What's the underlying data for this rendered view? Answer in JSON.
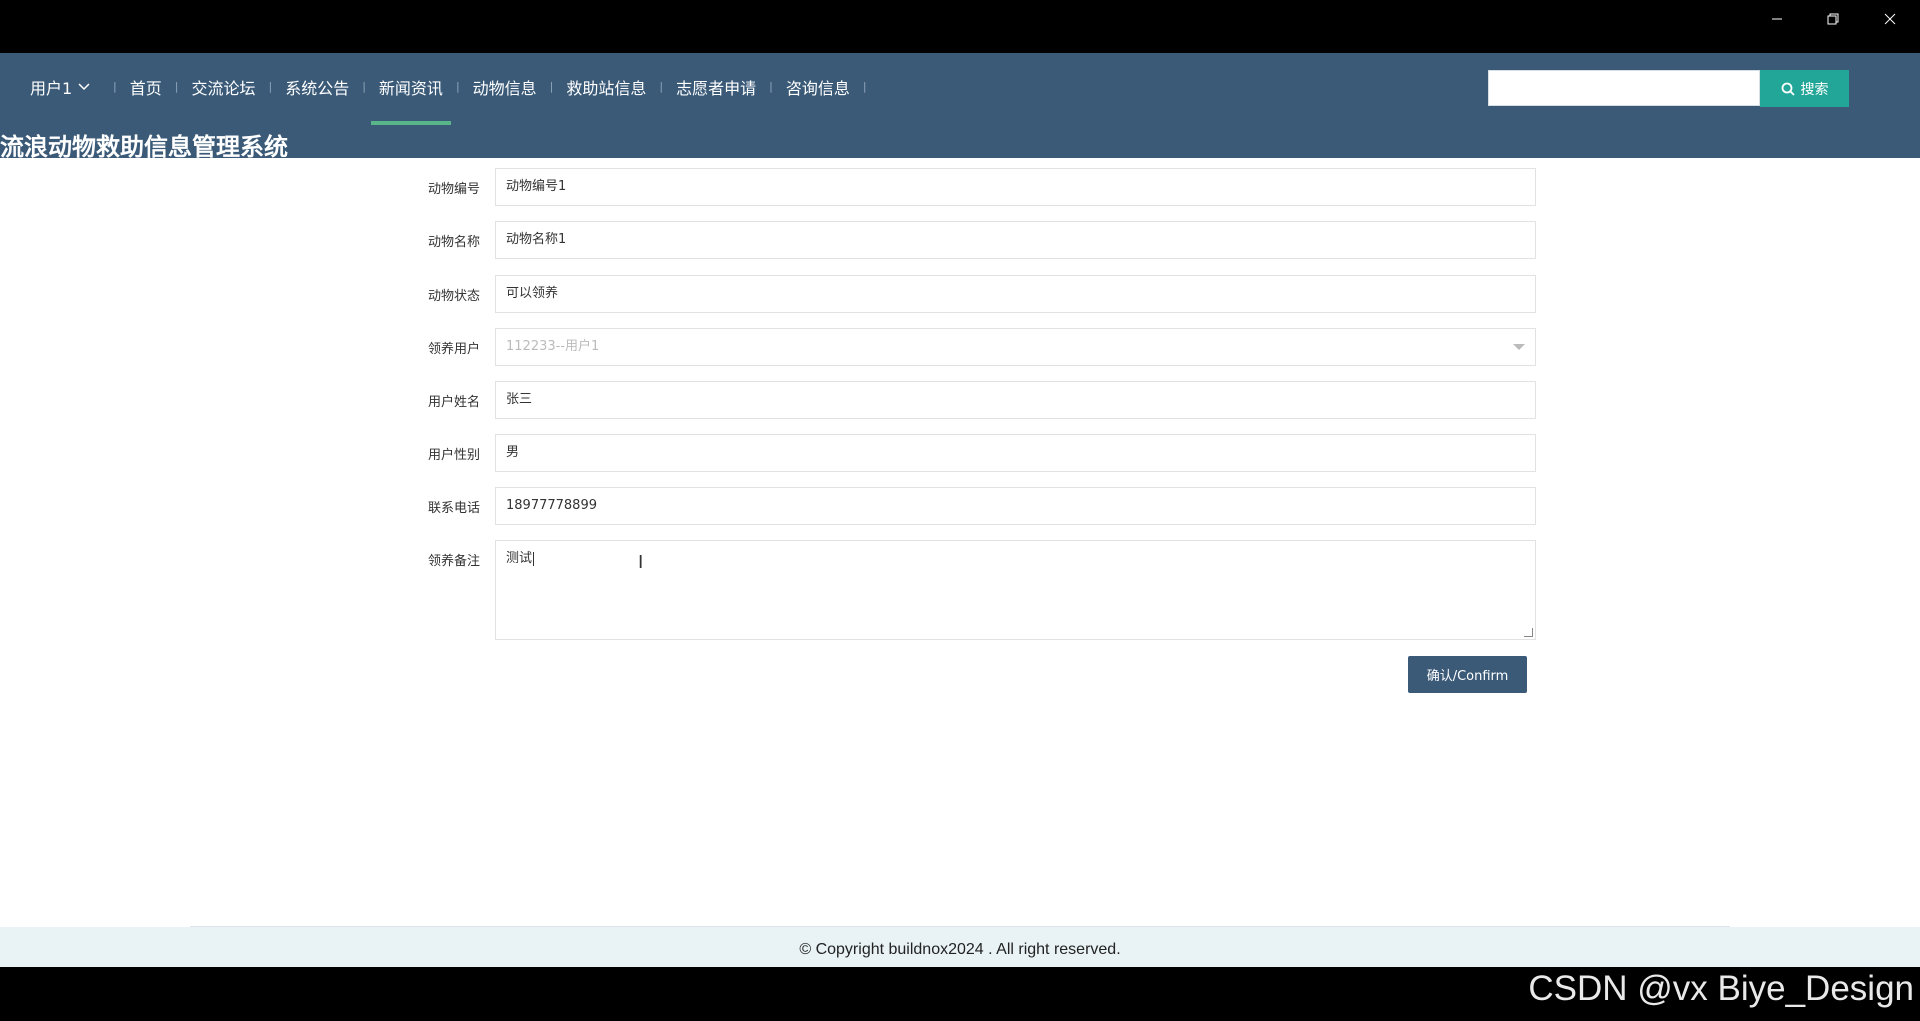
{
  "window": {
    "min_icon": "minimize-icon",
    "max_icon": "restore-icon",
    "close_icon": "close-icon"
  },
  "nav": {
    "user": "用户1",
    "items": [
      "首页",
      "交流论坛",
      "系统公告",
      "新闻资讯",
      "动物信息",
      "救助站信息",
      "志愿者申请",
      "咨询信息"
    ],
    "active_index": 3,
    "search_placeholder": "",
    "search_label": "搜索",
    "site_title": "流浪动物救助信息管理系统"
  },
  "form": {
    "fields": [
      {
        "label": "动物编号",
        "value": "动物编号1"
      },
      {
        "label": "动物名称",
        "value": "动物名称1"
      },
      {
        "label": "动物状态",
        "value": "可以领养"
      },
      {
        "label": "领养用户",
        "value": "112233--用户1"
      },
      {
        "label": "用户姓名",
        "value": "张三"
      },
      {
        "label": "用户性别",
        "value": "男"
      },
      {
        "label": "联系电话",
        "value": "18977778899"
      },
      {
        "label": "领养备注",
        "value": "测试"
      }
    ],
    "confirm_label": "确认/Confirm"
  },
  "footer": {
    "copyright": "© Copyright buildnox2024 . All right reserved."
  },
  "watermark": "CSDN @vx Biye_Design",
  "colors": {
    "nav_bg": "#3a5a78",
    "active_underline": "#58b58a",
    "search_button": "#22a698",
    "confirm_button": "#3a5a78"
  }
}
